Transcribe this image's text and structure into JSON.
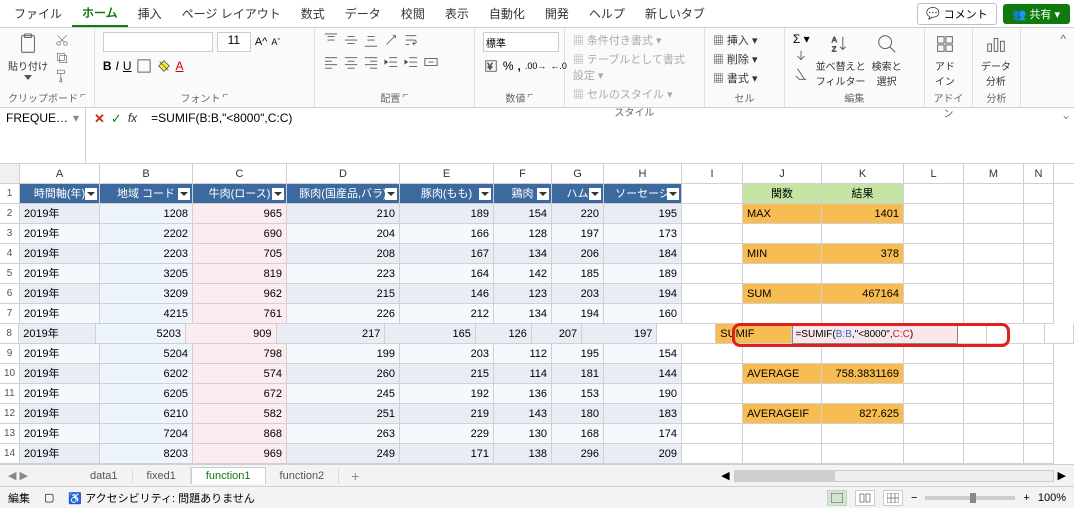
{
  "tabs": {
    "file": "ファイル",
    "home": "ホーム",
    "insert": "挿入",
    "pagelayout": "ページ レイアウト",
    "formulas": "数式",
    "data": "データ",
    "review": "校閲",
    "view": "表示",
    "automate": "自動化",
    "developer": "開発",
    "help": "ヘルプ",
    "newtab": "新しいタブ",
    "comment": "コメント",
    "share": "共有"
  },
  "ribbon": {
    "paste": "貼り付け",
    "g_clipboard": "クリップボード",
    "g_font": "フォント",
    "g_align": "配置",
    "g_number": "数値",
    "g_styles": "スタイル",
    "g_cells": "セル",
    "g_edit": "編集",
    "g_addin": "アドイン",
    "g_analysis": "分析",
    "fontsize": "11",
    "insert": "挿入",
    "delete": "削除",
    "format": "書式",
    "number_fmt": "標準",
    "cond_fmt": "条件付き書式",
    "as_table": "テーブルとして書式設定",
    "cell_style": "セルのスタイル",
    "sort_filter": "並べ替えと\nフィルター",
    "find_select": "検索と\n選択",
    "addin": "アド\nイン",
    "analysis": "データ\n分析"
  },
  "fbar": {
    "name": "FREQUE…",
    "formula": "=SUMIF(B:B,\"<8000\",C:C)"
  },
  "cols": [
    "A",
    "B",
    "C",
    "D",
    "E",
    "F",
    "G",
    "H",
    "I",
    "J",
    "K",
    "L",
    "M",
    "N"
  ],
  "headers": {
    "A": "時間軸(年)",
    "B": "地域 コード",
    "C": "牛肉(ロース)",
    "D": "豚肉(国産品,バラ)",
    "E": "豚肉(もも)",
    "F": "鶏肉",
    "G": "ハム",
    "H": "ソーセージ"
  },
  "side": {
    "j_hdr": "関数",
    "k_hdr": "結果",
    "max": "MAX",
    "max_v": "1401",
    "min": "MIN",
    "min_v": "378",
    "sum": "SUM",
    "sum_v": "467164",
    "sumif": "SUMIF",
    "sumif_v": "=SUMIF(B:B,\"<8000\",C:C)",
    "avg": "AVERAGE",
    "avg_v": "758.3831169",
    "avgif": "AVERAGEIF",
    "avgif_v": "827.625"
  },
  "rows": [
    {
      "n": 1
    },
    {
      "n": 2,
      "A": "2019年",
      "B": "1208",
      "C": "965",
      "D": "210",
      "E": "189",
      "F": "154",
      "G": "220",
      "H": "195"
    },
    {
      "n": 3,
      "A": "2019年",
      "B": "2202",
      "C": "690",
      "D": "204",
      "E": "166",
      "F": "128",
      "G": "197",
      "H": "173"
    },
    {
      "n": 4,
      "A": "2019年",
      "B": "2203",
      "C": "705",
      "D": "208",
      "E": "167",
      "F": "134",
      "G": "206",
      "H": "184"
    },
    {
      "n": 5,
      "A": "2019年",
      "B": "3205",
      "C": "819",
      "D": "223",
      "E": "164",
      "F": "142",
      "G": "185",
      "H": "189"
    },
    {
      "n": 6,
      "A": "2019年",
      "B": "3209",
      "C": "962",
      "D": "215",
      "E": "146",
      "F": "123",
      "G": "203",
      "H": "194"
    },
    {
      "n": 7,
      "A": "2019年",
      "B": "4215",
      "C": "761",
      "D": "226",
      "E": "212",
      "F": "134",
      "G": "194",
      "H": "160"
    },
    {
      "n": 8,
      "A": "2019年",
      "B": "5203",
      "C": "909",
      "D": "217",
      "E": "165",
      "F": "126",
      "G": "207",
      "H": "197"
    },
    {
      "n": 9,
      "A": "2019年",
      "B": "5204",
      "C": "798",
      "D": "199",
      "E": "203",
      "F": "112",
      "G": "195",
      "H": "154"
    },
    {
      "n": 10,
      "A": "2019年",
      "B": "6202",
      "C": "574",
      "D": "260",
      "E": "215",
      "F": "114",
      "G": "181",
      "H": "144"
    },
    {
      "n": 11,
      "A": "2019年",
      "B": "6205",
      "C": "672",
      "D": "245",
      "E": "192",
      "F": "136",
      "G": "153",
      "H": "190"
    },
    {
      "n": 12,
      "A": "2019年",
      "B": "6210",
      "C": "582",
      "D": "251",
      "E": "219",
      "F": "143",
      "G": "180",
      "H": "183"
    },
    {
      "n": 13,
      "A": "2019年",
      "B": "7204",
      "C": "868",
      "D": "263",
      "E": "229",
      "F": "130",
      "G": "168",
      "H": "174"
    },
    {
      "n": 14,
      "A": "2019年",
      "B": "8203",
      "C": "969",
      "D": "249",
      "E": "171",
      "F": "138",
      "G": "296",
      "H": "209"
    }
  ],
  "sheets": {
    "nav": "◀ ▶",
    "data1": "data1",
    "fixed1": "fixed1",
    "function1": "function1",
    "function2": "function2"
  },
  "status": {
    "mode": "編集",
    "acc": "アクセシビリティ: 問題ありません",
    "zoom": "100%"
  }
}
